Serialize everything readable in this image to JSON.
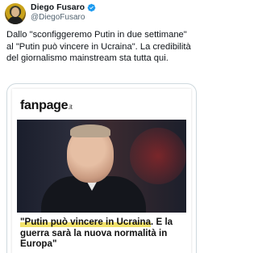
{
  "author": {
    "display_name": "Diego Fusaro",
    "handle": "@DiegoFusaro",
    "verified_icon": "verified-badge-icon",
    "verified_color": "#1d9bf0"
  },
  "tweet": {
    "text": "Dallo \"sconfiggeremo Putin in due settimane\" al \"Putin può vincere in Ucraina\". La credibilità del giornalismo mainstream sta tutta qui."
  },
  "card": {
    "logo_main": "fanpage",
    "logo_tld": ".it",
    "headline_highlight": "\"Putin può vincere in Ucraina",
    "headline_rest": ". E la guerra sarà la nuova normalità in Europa\"",
    "highlight_color": "#f2e26a"
  }
}
